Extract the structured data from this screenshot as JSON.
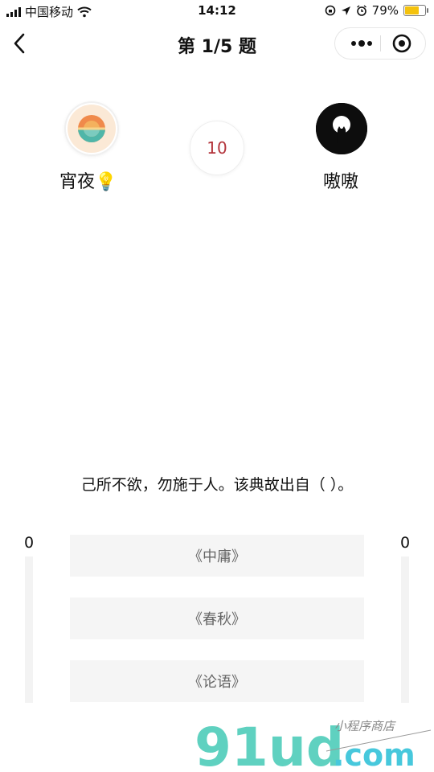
{
  "status_bar": {
    "carrier": "中国移动",
    "time": "14:12",
    "battery_percent": "79%",
    "battery_level": 0.79,
    "battery_color": "#f4c20d"
  },
  "nav": {
    "title": "第 1/5 题",
    "back_icon": "chevron-left-icon",
    "more_icon": "more-dots-icon",
    "close_icon": "target-close-icon"
  },
  "players": {
    "left": {
      "name": "宵夜💡",
      "score": "0"
    },
    "right": {
      "name": "嗷嗷",
      "score": "0"
    }
  },
  "timer": {
    "value": "10",
    "color": "#b3343b"
  },
  "question": {
    "text": "己所不欲，勿施于人。该典故出自（ ）。",
    "options": [
      {
        "label": "《中庸》"
      },
      {
        "label": "《春秋》"
      },
      {
        "label": "《论语》"
      }
    ]
  },
  "watermark": {
    "brand": "91ud",
    "suffix": ".com",
    "tagline": "小程序商店"
  }
}
